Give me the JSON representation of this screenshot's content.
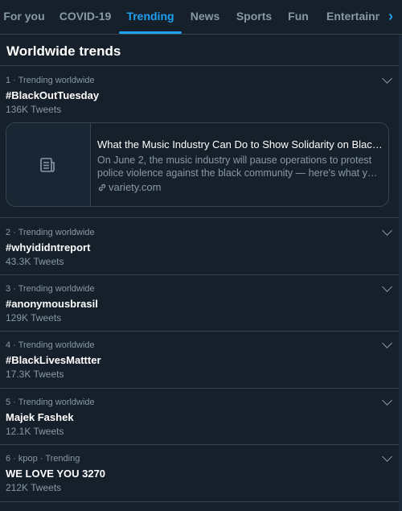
{
  "tabs": [
    {
      "label": "For you"
    },
    {
      "label": "COVID-19"
    },
    {
      "label": "Trending",
      "active": true
    },
    {
      "label": "News"
    },
    {
      "label": "Sports"
    },
    {
      "label": "Fun"
    },
    {
      "label": "Entertainment"
    }
  ],
  "section_title": "Worldwide trends",
  "trends": [
    {
      "meta": "1 · Trending worldwide",
      "name": "#BlackOutTuesday",
      "count": "136K Tweets"
    },
    {
      "meta": "2 · Trending worldwide",
      "name": "#whyididntreport",
      "count": "43.3K Tweets"
    },
    {
      "meta": "3 · Trending worldwide",
      "name": "#anonymousbrasil",
      "count": "129K Tweets"
    },
    {
      "meta": "4 · Trending worldwide",
      "name": "#BlackLivesMattter",
      "count": "17.3K Tweets"
    },
    {
      "meta": "5 · Trending worldwide",
      "name": "Majek Fashek",
      "count": "12.1K Tweets"
    },
    {
      "meta": "6 · kpop · Trending",
      "name": "WE LOVE YOU 3270",
      "count": "212K Tweets"
    }
  ],
  "card": {
    "title": "What the Music Industry Can Do to Show Solidarity on Blacko…",
    "description": "On June 2, the music industry will pause operations to protest police violence against the black community — here's what y…",
    "link": "variety.com"
  },
  "colors": {
    "background": "#15202b",
    "accent": "#1da1f2",
    "secondary_text": "#8899a6",
    "divider": "#38444d"
  }
}
